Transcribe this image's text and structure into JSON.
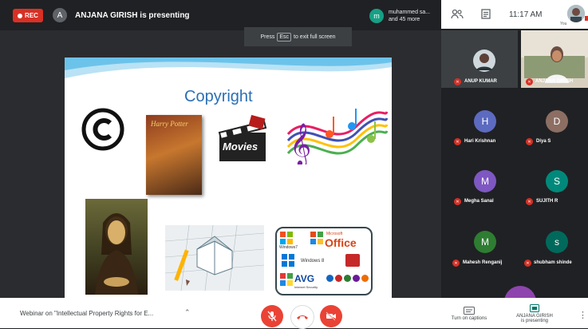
{
  "topbar": {
    "rec_label": "REC",
    "presenter_initial": "A",
    "presenter_text": "ANJANA GIRISH is presenting",
    "others_initial": "m",
    "others_line1": "muhammed sa...",
    "others_line2": "and 45 more"
  },
  "fullscreen_hint": {
    "press": "Press",
    "key": "Esc",
    "rest": "to exit full screen"
  },
  "header_right": {
    "time": "11:17 AM",
    "you_label": "You"
  },
  "slide": {
    "title": "Copyright",
    "book_text": "Harry Potter",
    "movies_text": "Movies",
    "office_brand": "Microsoft",
    "office_text": "Office",
    "windows7_text": "Windows7",
    "windows8_text": "Windows 8",
    "avg_text": "AVG",
    "avg_sub": "Internet Security"
  },
  "participants": [
    {
      "name": "ANUP KUMAR",
      "initial": "",
      "color": "#3c4043"
    },
    {
      "name": "ANJANA GIRISH",
      "initial": "",
      "color": "#3c4043"
    },
    {
      "name": "Hari Krishnan",
      "initial": "H",
      "color": "#5c6bc0"
    },
    {
      "name": "Diya S",
      "initial": "D",
      "color": "#8d6e63"
    },
    {
      "name": "Megha Sanal",
      "initial": "M",
      "color": "#7e57c2"
    },
    {
      "name": "SUJITH R",
      "initial": "S",
      "color": "#00897b"
    },
    {
      "name": "Mahesh Renganij",
      "initial": "M",
      "color": "#2e7d32"
    },
    {
      "name": "shubham shinde",
      "initial": "s",
      "color": "#00695c"
    }
  ],
  "bottombar": {
    "meeting_title": "Webinar on \"Intellectual Property Rights for E...",
    "captions_label": "Turn on captions",
    "presenter_name": "ANJANA GIRISH",
    "presenter_status": "is presenting"
  },
  "colors": {
    "mic_off_red": "#d93025",
    "rec_red": "#d93025",
    "background": "#202124"
  }
}
